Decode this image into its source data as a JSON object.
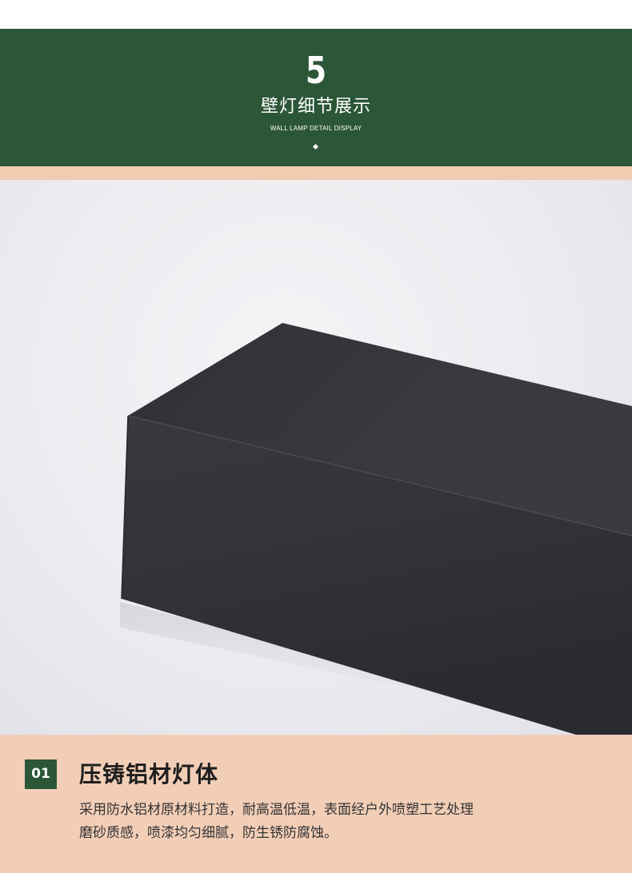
{
  "header": {
    "number": "5",
    "title": "壁灯细节展示",
    "subtitle": "WALL LAMP DETAIL DISPLAY",
    "accent_color": "#2b5637"
  },
  "photo": {
    "subject": "black-aluminum-lamp-body"
  },
  "feature": {
    "badge": "01",
    "title": "压铸铝材灯体",
    "description_lines": [
      "采用防水铝材原材料打造，耐高温低温，表面经户外喷塑工艺处理",
      "磨砂质感，喷漆均匀细腻，防生锈防腐蚀。"
    ],
    "background_color": "#f2ceb7"
  }
}
